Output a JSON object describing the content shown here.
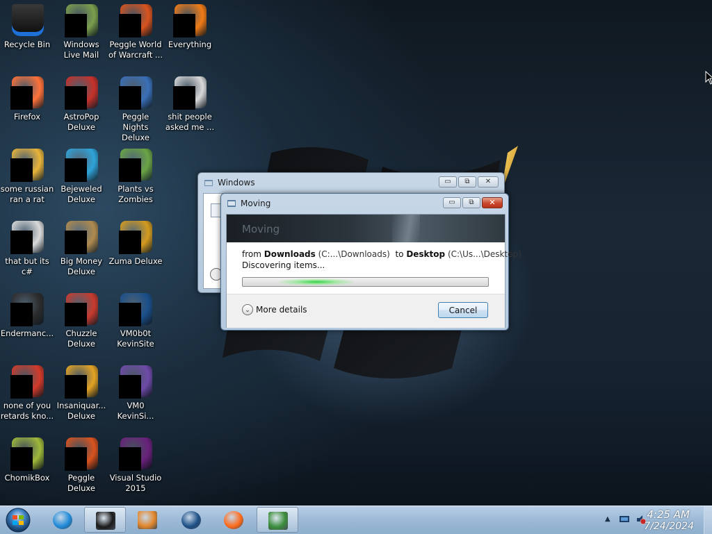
{
  "desktop": {
    "icons": [
      {
        "label": "Recycle Bin",
        "color": "#1b1b1b"
      },
      {
        "label": "Windows Live Mail",
        "color": "#7a9e4c"
      },
      {
        "label": "Peggle World of Warcraft ...",
        "color": "#d9531e"
      },
      {
        "label": "Everything",
        "color": "#f07b16"
      },
      {
        "label": "Firefox",
        "color": "#ff7139"
      },
      {
        "label": "AstroPop Deluxe",
        "color": "#c6312b"
      },
      {
        "label": "Peggle Nights Deluxe",
        "color": "#3a6fb7"
      },
      {
        "label": "shit people asked me ...",
        "color": "#d8d8d8"
      },
      {
        "label": "some russian ran a rat",
        "color": "#e8b43a"
      },
      {
        "label": "Bejeweled Deluxe",
        "color": "#2fa3d8"
      },
      {
        "label": "Plants vs Zombies",
        "color": "#6aa444"
      },
      {
        "label": "that but its c#",
        "color": "#d9d9d9"
      },
      {
        "label": "Big Money Deluxe",
        "color": "#b08a4e"
      },
      {
        "label": "Zuma Deluxe",
        "color": "#d49a1d"
      },
      {
        "label": "Endermanc...",
        "color": "#2b2b2b"
      },
      {
        "label": "Chuzzle Deluxe",
        "color": "#c83a2d"
      },
      {
        "label": "VM0b0t KevinSite",
        "color": "#1b4f8a"
      },
      {
        "label": "none of you retards kno...",
        "color": "#d23a2a"
      },
      {
        "label": "Insaniquar... Deluxe",
        "color": "#e3a323"
      },
      {
        "label": "VM0 KevinSi...",
        "color": "#6e4aa8"
      },
      {
        "label": "ChomikBox",
        "color": "#9fb83a"
      },
      {
        "label": "Peggle Deluxe",
        "color": "#d9531e"
      },
      {
        "label": "Visual Studio 2015",
        "color": "#68217a"
      }
    ]
  },
  "bg_window": {
    "title": "Windows",
    "minimize_glyph": "▭",
    "restore_glyph": "⧉",
    "close_glyph": "✕"
  },
  "moving_dialog": {
    "title": "Moving",
    "banner": "Moving",
    "from_word": "from",
    "source_name": "Downloads",
    "source_path": "(C:...\\Downloads)",
    "to_word": "to",
    "dest_name": "Desktop",
    "dest_path": "(C:\\Us...\\Desktop)",
    "status": "Discovering items...",
    "progress": 0.3,
    "more_details": "More details",
    "chevron_glyph": "⌄",
    "cancel": "Cancel",
    "minimize_glyph": "▭",
    "restore_glyph": "⧉",
    "close_glyph": "✕"
  },
  "taskbar": {
    "items": [
      {
        "icon": "internet-explorer-icon",
        "color": "#1f8ad8",
        "active": false
      },
      {
        "icon": "terminal-box-icon",
        "color": "#1a1a1a",
        "active": true
      },
      {
        "icon": "media-player-icon",
        "color": "#e2862a",
        "active": false
      },
      {
        "icon": "globe-icon",
        "color": "#1d4f86",
        "active": false
      },
      {
        "icon": "firefox-icon",
        "color": "#ff6a1a",
        "active": false
      },
      {
        "icon": "move-dialog-icon",
        "color": "#3b8d3b",
        "active": true
      }
    ],
    "clock_time": "4:25 AM",
    "clock_date": "7/24/2024"
  }
}
